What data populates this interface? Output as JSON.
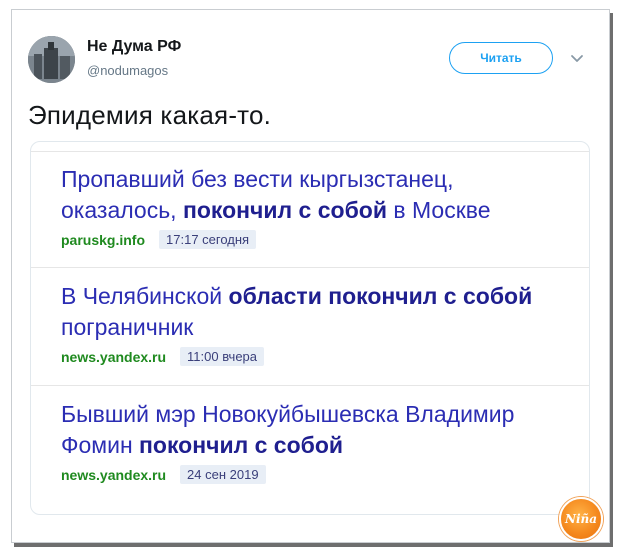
{
  "tweet": {
    "author_name": "Не Дума РФ",
    "author_handle": "@nodumagos",
    "follow_label": "Читать",
    "text": "Эпидемия какая-то."
  },
  "news": [
    {
      "headline_parts": [
        {
          "text": "Пропавший без вести кыргызстанец, оказалось, ",
          "bold": false
        },
        {
          "text": "покончил с собой",
          "bold": true
        },
        {
          "text": " в Москве",
          "bold": false
        }
      ],
      "source": "paruskg.info",
      "time": "17:17 сегодня"
    },
    {
      "headline_parts": [
        {
          "text": "В Челябинской ",
          "bold": false
        },
        {
          "text": "области покончил с собой",
          "bold": true
        },
        {
          "text": " пограничник",
          "bold": false
        }
      ],
      "source": "news.yandex.ru",
      "time": "11:00 вчера"
    },
    {
      "headline_parts": [
        {
          "text": "Бывший мэр Новокуйбышевска Владимир Фомин ",
          "bold": false
        },
        {
          "text": "покончил с собой",
          "bold": true
        }
      ],
      "source": "news.yandex.ru",
      "time": "24 сен 2019"
    }
  ],
  "watermark": {
    "text": "Niña"
  },
  "icons": {
    "chevron": "chevron-down-icon",
    "avatar": "avatar-image"
  },
  "colors": {
    "accent": "#1da1f2",
    "headline": "#2b2db3",
    "source": "#1f8a1f",
    "time_bg": "#e8eef6"
  }
}
